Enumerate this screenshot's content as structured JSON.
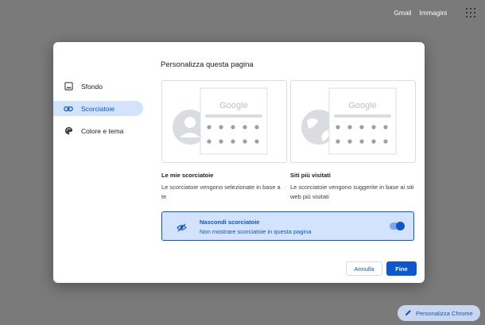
{
  "header": {
    "gmail": "Gmail",
    "images": "Immagini"
  },
  "dialog": {
    "title": "Personalizza questa pagina",
    "nav": [
      {
        "label": "Sfondo",
        "icon": "image-icon",
        "active": false
      },
      {
        "label": "Scorciatoie",
        "icon": "link-icon",
        "active": true
      },
      {
        "label": "Colore e tema",
        "icon": "palette-icon",
        "active": false
      }
    ],
    "options": [
      {
        "preview_logo": "Google",
        "title": "Le mie scorciatoie",
        "description": "Le scorciatoie vengono selezionate in base a te"
      },
      {
        "preview_logo": "Google",
        "title": "Siti più visitati",
        "description": "Le scorciatoie vengono suggerite in base ai siti web più visitati"
      }
    ],
    "hide": {
      "title": "Nascondi scorciatoie",
      "subtitle": "Non mostrare scorciatoie in questa pagina",
      "enabled": true
    },
    "buttons": {
      "cancel": "Annulla",
      "done": "Fine"
    }
  },
  "customize_chrome": {
    "label": "Personalizza Chrome",
    "icon": "pencil-icon"
  },
  "colors": {
    "accent": "#0b57d0",
    "selected_bg": "#d3e3fd",
    "overlay": "#7a7a7a"
  }
}
